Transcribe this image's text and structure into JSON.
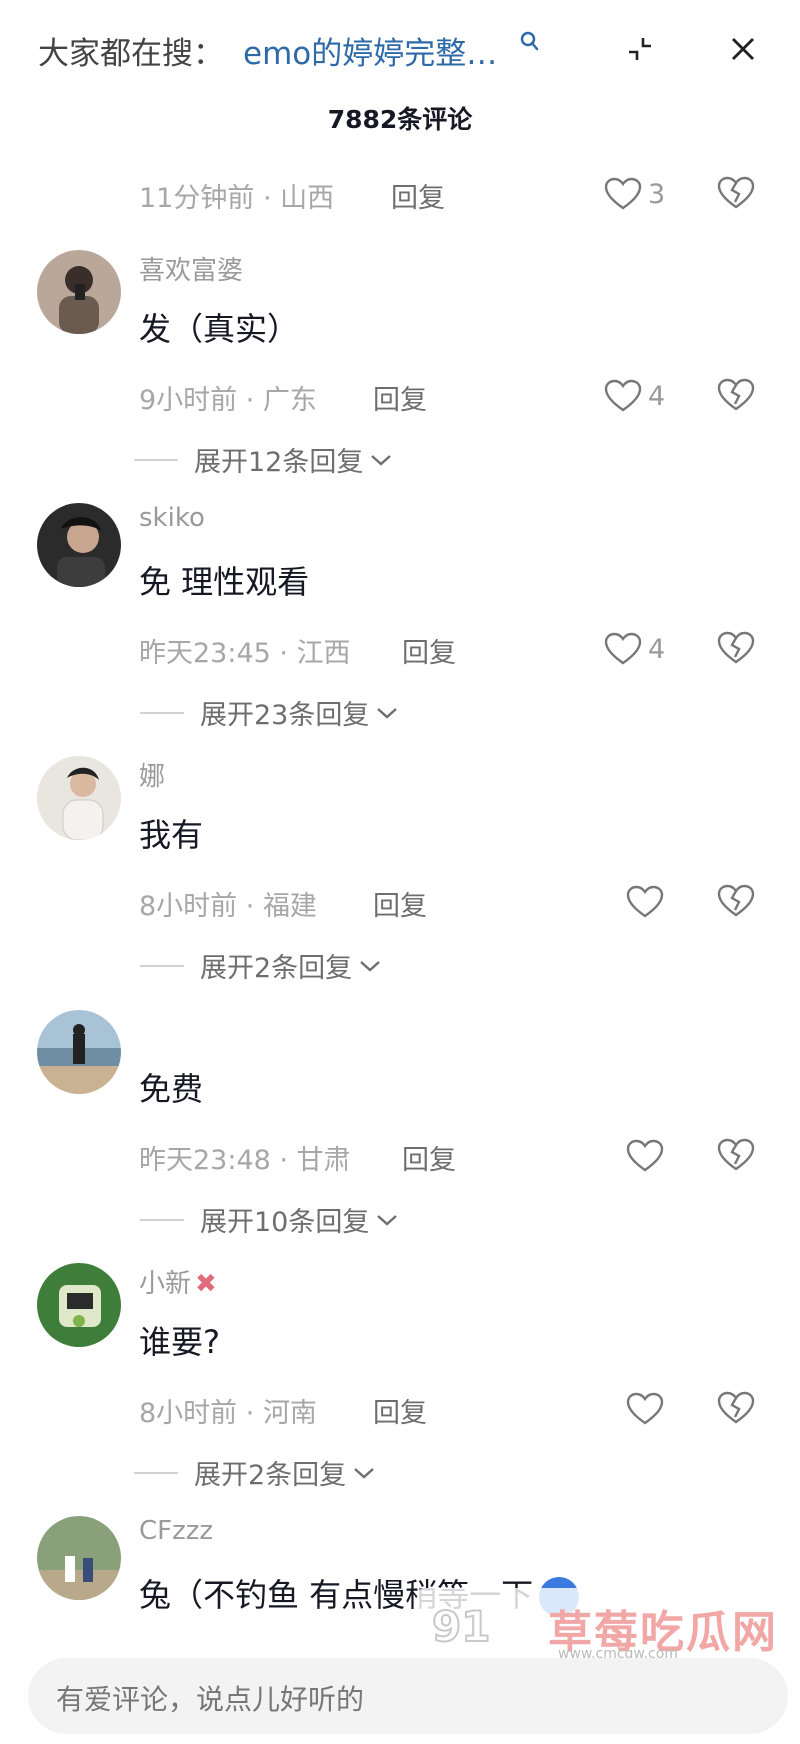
{
  "header": {
    "search_prefix": "大家都在搜：",
    "search_term": "emo的婷婷完整…",
    "comment_count": "7882条评论"
  },
  "comments": [
    {
      "username": "",
      "text": "",
      "time": "11分钟前",
      "location": "山西",
      "reply": "回复",
      "likes": "3",
      "expand": ""
    },
    {
      "username": "喜欢富婆",
      "text": "发（真实）",
      "time": "9小时前",
      "location": "广东",
      "reply": "回复",
      "likes": "4",
      "expand": "展开12条回复"
    },
    {
      "username": "skiko",
      "text": "免 理性观看",
      "time": "昨天23:45",
      "location": "江西",
      "reply": "回复",
      "likes": "4",
      "expand": "展开23条回复"
    },
    {
      "username": "娜",
      "text": "我有",
      "time": "8小时前",
      "location": "福建",
      "reply": "回复",
      "likes": "",
      "expand": "展开2条回复"
    },
    {
      "username": "",
      "text": "免费",
      "time": "昨天23:48",
      "location": "甘肃",
      "reply": "回复",
      "likes": "",
      "expand": "展开10条回复"
    },
    {
      "username": "小新",
      "text": "谁要?",
      "time": "8小时前",
      "location": "河南",
      "reply": "回复",
      "likes": "",
      "expand": "展开2条回复"
    },
    {
      "username": "CFzzz",
      "text": "兔（不钓鱼 有点慢稍等一下",
      "time": "",
      "location": "",
      "reply": "",
      "likes": "",
      "expand": ""
    }
  ],
  "input": {
    "placeholder": "有爱评论，说点儿好听的"
  },
  "watermark": {
    "logo": "91",
    "name": "草莓吃瓜网",
    "url": "www.cmcgw.com"
  },
  "colors": {
    "accent": "#2f6aa8",
    "muted": "#a7a7a7"
  },
  "icons": [
    "search-icon",
    "collapse-icon",
    "close-icon",
    "heart-icon",
    "broken-heart-icon",
    "chevron-down-icon"
  ]
}
